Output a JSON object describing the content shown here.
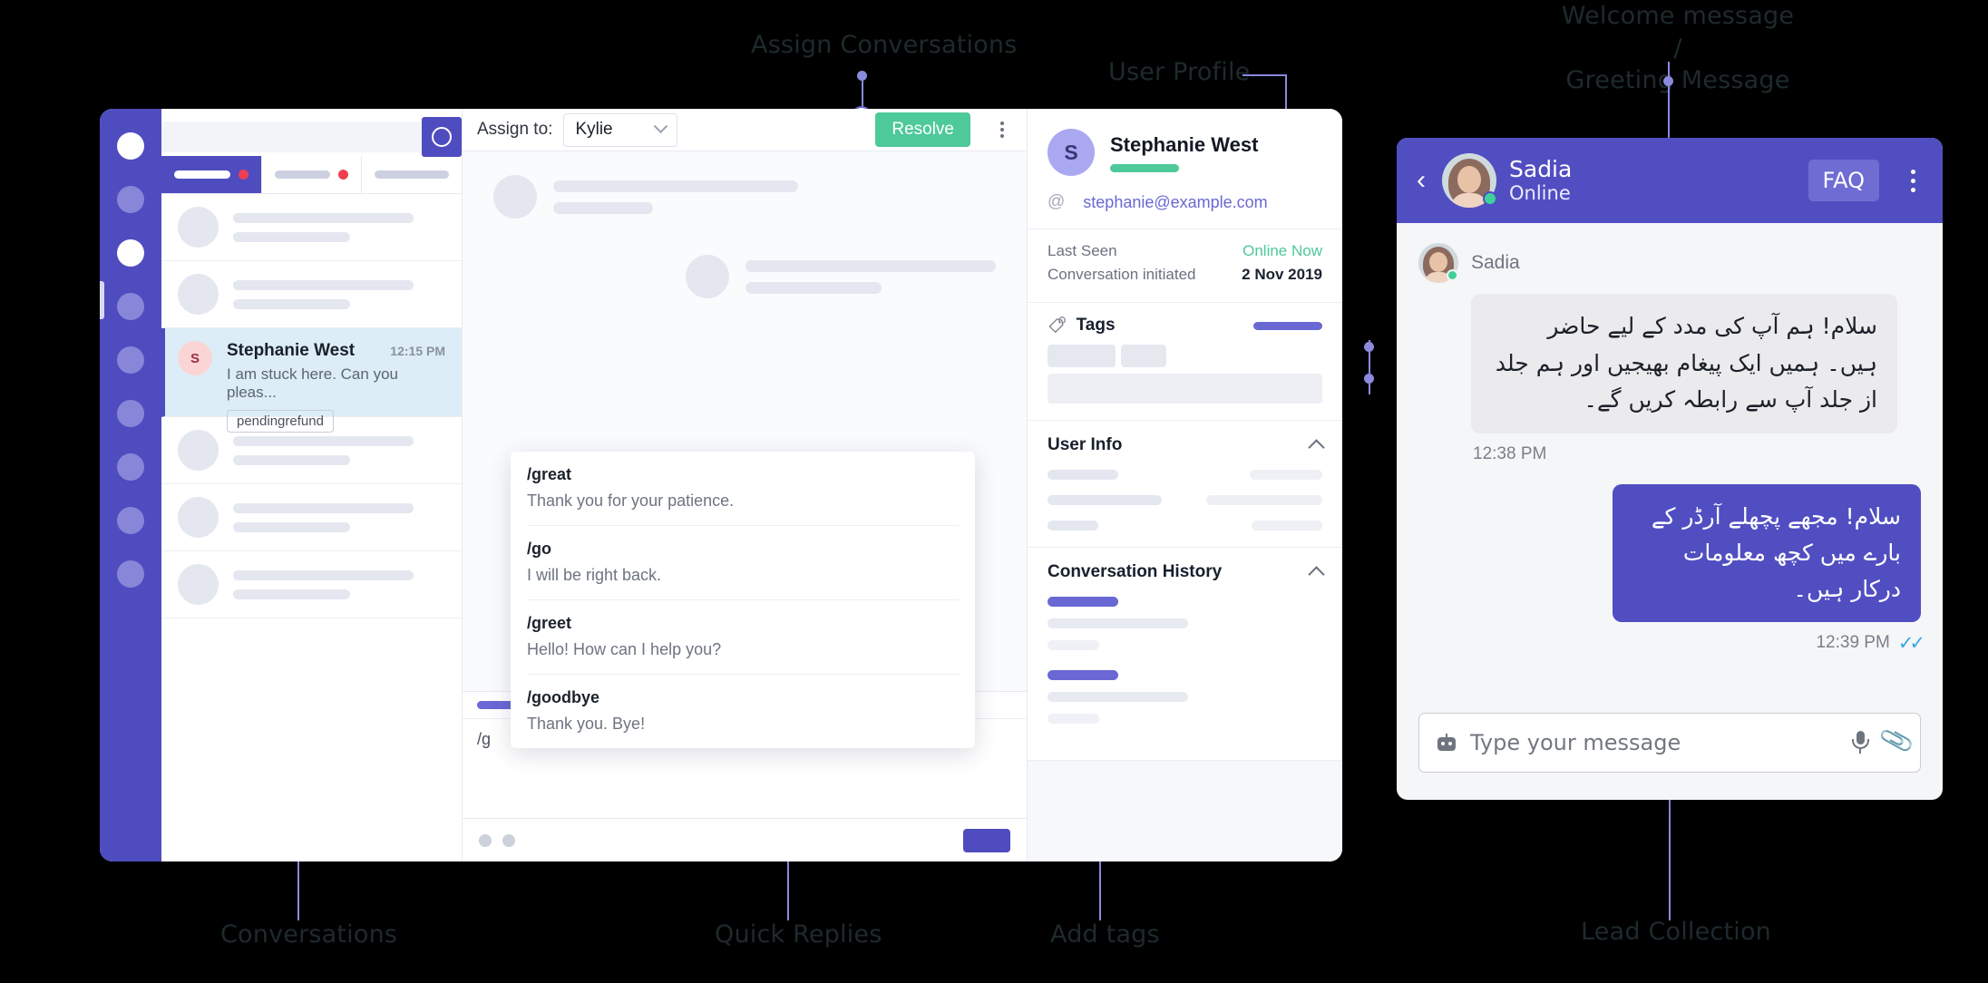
{
  "annotations": [
    {
      "id": "assign-conversations",
      "text": "Assign Conversations"
    },
    {
      "id": "user-profile",
      "text": "User Profile"
    },
    {
      "id": "welcome-message",
      "text": "Welcome message /\nGreeting Message"
    },
    {
      "id": "conversations",
      "text": "Conversations"
    },
    {
      "id": "quick-replies",
      "text": "Quick Replies"
    },
    {
      "id": "add-tags",
      "text": "Add tags"
    },
    {
      "id": "lead-collection",
      "text": "Lead Collection"
    }
  ],
  "dashboard": {
    "conversation_list": {
      "selected": {
        "avatar_initial": "S",
        "name": "Stephanie West",
        "time": "12:15 PM",
        "preview": "I am stuck here. Can you pleas...",
        "tag": "pendingrefund"
      }
    },
    "center": {
      "assign_label": "Assign to:",
      "assign_value": "Kylie",
      "resolve_label": "Resolve",
      "composer_text": "/g",
      "quick_replies": [
        {
          "command": "/great",
          "text": "Thank you for your patience."
        },
        {
          "command": "/go",
          "text": "I will be right back."
        },
        {
          "command": "/greet",
          "text": "Hello! How can I help you?"
        },
        {
          "command": "/goodbye",
          "text": "Thank you. Bye!"
        }
      ]
    },
    "profile": {
      "avatar_initial": "S",
      "name": "Stephanie West",
      "email": "stephanie@example.com",
      "at_symbol": "@",
      "meta": [
        {
          "key": "Last Seen",
          "value": "Online Now",
          "style": "green"
        },
        {
          "key": "Conversation initiated",
          "value": "2 Nov 2019",
          "style": "bold"
        }
      ],
      "tags_title": "Tags",
      "user_info_title": "User Info",
      "conversation_history_title": "Conversation History"
    }
  },
  "widget": {
    "header": {
      "name": "Sadia",
      "status": "Online",
      "faq_label": "FAQ"
    },
    "messages": [
      {
        "sender": "Sadia",
        "direction": "in",
        "text": "سلام! ہم آپ کی مدد کے لیے حاضر ہیں۔ ہمیں ایک پیغام بھیجیں اور ہم جلد از جلد آپ سے رابطہ کریں گے۔",
        "time": "12:38 PM"
      },
      {
        "sender": "",
        "direction": "out",
        "text": "سلام! مجھے پچھلے آرڈر کے بارے میں کچھ معلومات درکار ہیں۔",
        "time": "12:39 PM"
      }
    ],
    "composer": {
      "placeholder": "Type your message"
    }
  },
  "colors": {
    "brand": "#4f4cc0",
    "widget_brand": "#514ec2",
    "accent_green": "#4ec99a",
    "notification_red": "#ef3e52",
    "annotation": "#8b8ade"
  }
}
